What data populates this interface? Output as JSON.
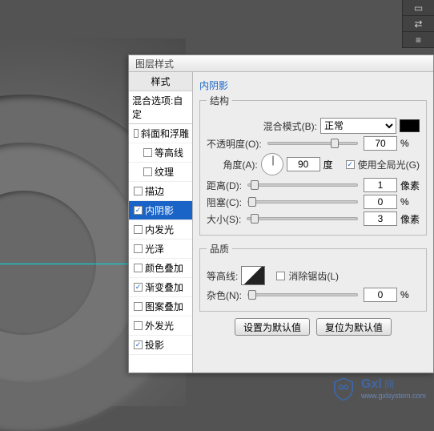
{
  "dialog": {
    "title": "图层样式"
  },
  "side": {
    "header": "样式",
    "sub": "混合选项:自定",
    "items": [
      {
        "label": "斜面和浮雕",
        "checked": false,
        "selected": false,
        "indent": false
      },
      {
        "label": "等高线",
        "checked": false,
        "selected": false,
        "indent": true
      },
      {
        "label": "纹理",
        "checked": false,
        "selected": false,
        "indent": true
      },
      {
        "label": "描边",
        "checked": false,
        "selected": false,
        "indent": false
      },
      {
        "label": "内阴影",
        "checked": true,
        "selected": true,
        "indent": false
      },
      {
        "label": "内发光",
        "checked": false,
        "selected": false,
        "indent": false
      },
      {
        "label": "光泽",
        "checked": false,
        "selected": false,
        "indent": false
      },
      {
        "label": "颜色叠加",
        "checked": false,
        "selected": false,
        "indent": false
      },
      {
        "label": "渐变叠加",
        "checked": true,
        "selected": false,
        "indent": false
      },
      {
        "label": "图案叠加",
        "checked": false,
        "selected": false,
        "indent": false
      },
      {
        "label": "外发光",
        "checked": false,
        "selected": false,
        "indent": false
      },
      {
        "label": "投影",
        "checked": true,
        "selected": false,
        "indent": false
      }
    ]
  },
  "panel": {
    "title": "内阴影",
    "group1": "结构",
    "group2": "品质",
    "blendMode": {
      "label": "混合模式(B):",
      "value": "正常"
    },
    "opacity": {
      "label": "不透明度(O):",
      "value": "70",
      "unit": "%",
      "pos": 70
    },
    "angle": {
      "label": "角度(A):",
      "value": "90",
      "unit": "度"
    },
    "global": {
      "label": "使用全局光(G)",
      "checked": true
    },
    "distance": {
      "label": "距离(D):",
      "value": "1",
      "unit": "像素",
      "pos": 2
    },
    "choke": {
      "label": "阻塞(C):",
      "value": "0",
      "unit": "%",
      "pos": 0
    },
    "size": {
      "label": "大小(S):",
      "value": "3",
      "unit": "像素",
      "pos": 3
    },
    "contour": {
      "label": "等高线:"
    },
    "antialias": {
      "label": "消除锯齿(L)",
      "checked": false
    },
    "noise": {
      "label": "杂色(N):",
      "value": "0",
      "unit": "%",
      "pos": 0
    },
    "btnDefault": "设置为默认值",
    "btnReset": "复位为默认值"
  },
  "watermark": {
    "text1": "Gxl",
    "text2": "网",
    "url": "www.gxlsystem.com"
  }
}
